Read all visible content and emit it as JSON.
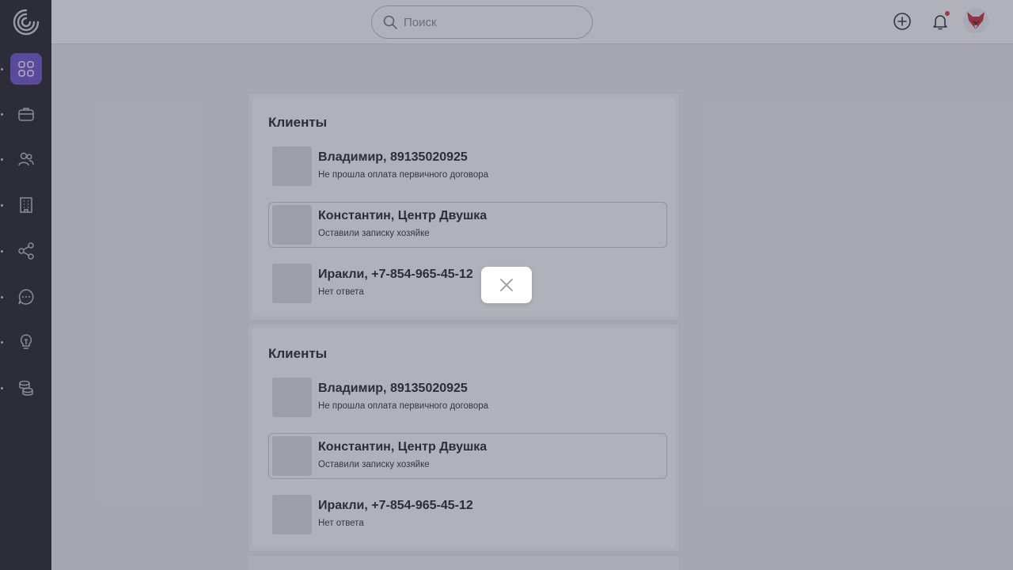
{
  "header": {
    "search_placeholder": "Поиск",
    "add_icon": "plus-circle-icon",
    "notifications_icon": "bell-icon",
    "notification_badge_color": "#e0303a",
    "avatar_icon": "fox-avatar"
  },
  "sidebar": {
    "logo_icon": "spiral-logo",
    "active_color": "#6b4fc9",
    "items": [
      {
        "icon": "grid-icon",
        "active": true
      },
      {
        "icon": "briefcase-icon",
        "active": false
      },
      {
        "icon": "users-icon",
        "active": false
      },
      {
        "icon": "building-icon",
        "active": false
      },
      {
        "icon": "share-icon",
        "active": false
      },
      {
        "icon": "chat-icon",
        "active": false
      },
      {
        "icon": "lightbulb-icon",
        "active": false
      },
      {
        "icon": "coins-icon",
        "active": false
      }
    ]
  },
  "panels": [
    {
      "title": "Клиенты",
      "clients": [
        {
          "name": "Владимир, 89135020925",
          "status": "Не прошла оплата первичного договора"
        },
        {
          "name": "Константин, Центр Двушка",
          "status": "Оставили записку хозяйке"
        },
        {
          "name": "Иракли, +7-854-965-45-12",
          "status": "Нет ответа"
        }
      ]
    },
    {
      "title": "Клиенты",
      "clients": [
        {
          "name": "Владимир, 89135020925",
          "status": "Не прошла оплата первичного договора"
        },
        {
          "name": "Константин, Центр Двушка",
          "status": "Оставили записку хозяйке"
        },
        {
          "name": "Иракли, +7-854-965-45-12",
          "status": "Нет ответа"
        }
      ]
    }
  ],
  "overlay": {
    "close_icon": "close-icon"
  }
}
